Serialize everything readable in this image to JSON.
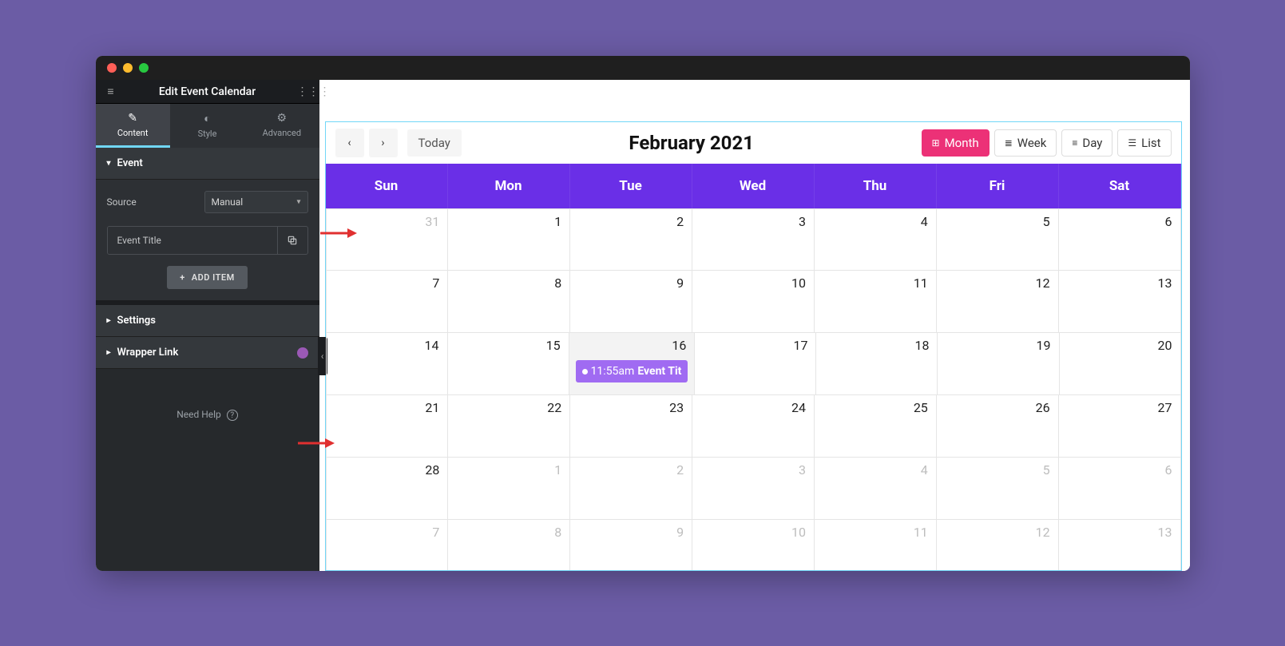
{
  "sidebar": {
    "title": "Edit Event Calendar",
    "tabs": [
      "Content",
      "Style",
      "Advanced"
    ],
    "active_tab": 0,
    "sections": {
      "event": {
        "label": "Event",
        "source_label": "Source",
        "source_value": "Manual",
        "items": [
          {
            "title": "Event Title"
          }
        ],
        "add_label": "ADD ITEM"
      },
      "settings": {
        "label": "Settings"
      },
      "wrapper_link": {
        "label": "Wrapper Link"
      }
    },
    "need_help": "Need Help"
  },
  "calendar": {
    "title": "February 2021",
    "today_label": "Today",
    "views": [
      "Month",
      "Week",
      "Day",
      "List"
    ],
    "active_view": 0,
    "day_headers": [
      "Sun",
      "Mon",
      "Tue",
      "Wed",
      "Thu",
      "Fri",
      "Sat"
    ],
    "weeks": [
      [
        {
          "n": "31",
          "muted": true
        },
        {
          "n": "1"
        },
        {
          "n": "2"
        },
        {
          "n": "3"
        },
        {
          "n": "4"
        },
        {
          "n": "5"
        },
        {
          "n": "6"
        }
      ],
      [
        {
          "n": "7"
        },
        {
          "n": "8"
        },
        {
          "n": "9"
        },
        {
          "n": "10"
        },
        {
          "n": "11"
        },
        {
          "n": "12"
        },
        {
          "n": "13"
        }
      ],
      [
        {
          "n": "14"
        },
        {
          "n": "15"
        },
        {
          "n": "16",
          "today": true,
          "event": {
            "time": "11:55am",
            "title": "Event Tit"
          }
        },
        {
          "n": "17"
        },
        {
          "n": "18"
        },
        {
          "n": "19"
        },
        {
          "n": "20"
        }
      ],
      [
        {
          "n": "21"
        },
        {
          "n": "22"
        },
        {
          "n": "23"
        },
        {
          "n": "24"
        },
        {
          "n": "25"
        },
        {
          "n": "26"
        },
        {
          "n": "27"
        }
      ],
      [
        {
          "n": "28"
        },
        {
          "n": "1",
          "muted": true
        },
        {
          "n": "2",
          "muted": true
        },
        {
          "n": "3",
          "muted": true
        },
        {
          "n": "4",
          "muted": true
        },
        {
          "n": "5",
          "muted": true
        },
        {
          "n": "6",
          "muted": true
        }
      ],
      [
        {
          "n": "7",
          "muted": true
        },
        {
          "n": "8",
          "muted": true
        },
        {
          "n": "9",
          "muted": true
        },
        {
          "n": "10",
          "muted": true
        },
        {
          "n": "11",
          "muted": true
        },
        {
          "n": "12",
          "muted": true
        },
        {
          "n": "13",
          "muted": true
        }
      ]
    ]
  }
}
